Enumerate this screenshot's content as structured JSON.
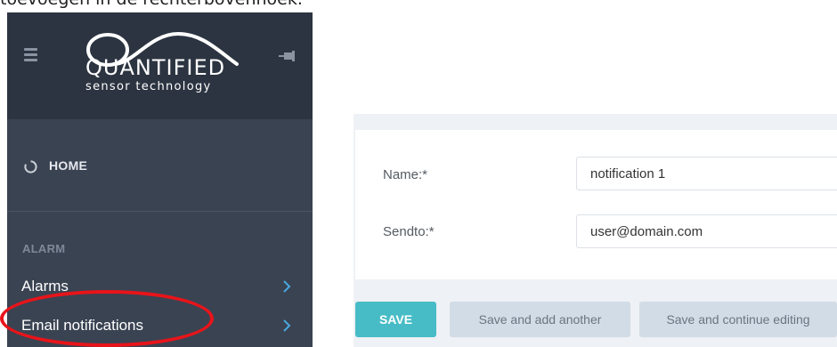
{
  "caption": "toevoegen in de rechterbovenhoek.",
  "brand": {
    "name": "QUANTIFIED",
    "tagline": "sensor technology"
  },
  "sidebar": {
    "home_label": "HOME",
    "section_label": "ALARM",
    "items": [
      {
        "label": "Alarms"
      },
      {
        "label": "Email notifications"
      }
    ]
  },
  "form": {
    "fields": [
      {
        "label": "Name:*",
        "value": "notification 1"
      },
      {
        "label": "Sendto:*",
        "value": "user@domain.com"
      }
    ]
  },
  "actions": {
    "save": "SAVE",
    "save_add": "Save and add another",
    "save_continue": "Save and continue editing"
  },
  "colors": {
    "sidebar": "#3a4352",
    "sidebar_header": "#2c3441",
    "primary_button": "#47bcc6",
    "highlight_ring": "#e8141a"
  },
  "icons": {
    "menu": "hamburger-icon",
    "pin": "pin-icon",
    "home": "circle-arrow-icon",
    "chevron": "chevron-right-icon"
  }
}
